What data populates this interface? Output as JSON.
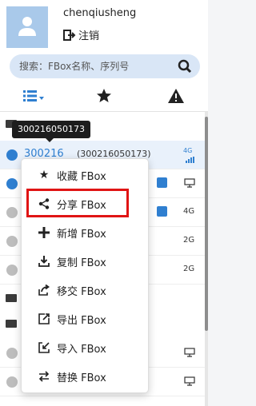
{
  "user": {
    "name": "chenqiusheng",
    "logout_label": "注销"
  },
  "search": {
    "placeholder": "搜索：FBox名称、序列号"
  },
  "toolbar": {
    "list_icon": "list-icon",
    "star_icon": "star-icon",
    "alert_icon": "alert-icon"
  },
  "tooltip": {
    "text": "300216050173"
  },
  "rows": [
    {
      "name": "300216",
      "serial": "(300216050173)",
      "network": "4G"
    },
    {
      "network": "4G"
    },
    {
      "network": "2G"
    },
    {
      "network": "2G"
    }
  ],
  "context_menu": {
    "items": [
      {
        "label": "收藏 FBox",
        "icon": "star-icon"
      },
      {
        "label": "分享 FBox",
        "icon": "share-icon"
      },
      {
        "label": "新增 FBox",
        "icon": "plus-icon"
      },
      {
        "label": "复制 FBox",
        "icon": "copy-icon"
      },
      {
        "label": "移交 FBox",
        "icon": "transfer-icon"
      },
      {
        "label": "导出 FBox",
        "icon": "export-icon"
      },
      {
        "label": "导入 FBox",
        "icon": "import-icon"
      },
      {
        "label": "替换 FBox",
        "icon": "replace-icon"
      }
    ]
  }
}
